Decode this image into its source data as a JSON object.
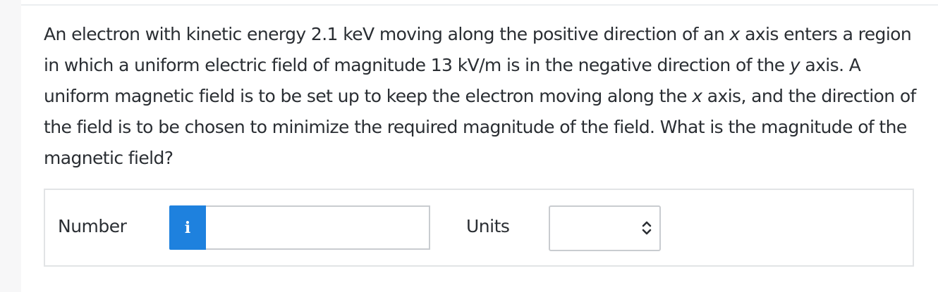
{
  "question": {
    "seg1": "An electron with kinetic energy 2.1 keV moving along the positive direction of an ",
    "var1": "x",
    "seg2": " axis enters a region in which a uniform electric field of magnitude 13 kV/m is in the negative direction of the ",
    "var2": "y",
    "seg3": " axis. A uniform magnetic field is to be set up to keep the electron moving along the ",
    "var3": "x",
    "seg4": " axis, and the direction of the field is to be chosen to minimize the required magnitude of the field. What is the magnitude of the magnetic field?"
  },
  "answer": {
    "number_label": "Number",
    "info_icon_glyph": "i",
    "number_value": "",
    "units_label": "Units",
    "units_selected": ""
  },
  "colors": {
    "info_button": "#1e81de",
    "text": "#2a2e33",
    "border": "#c9ccd0"
  },
  "icons": {
    "info": "info-icon",
    "select": "up-down-chevron-icon"
  }
}
